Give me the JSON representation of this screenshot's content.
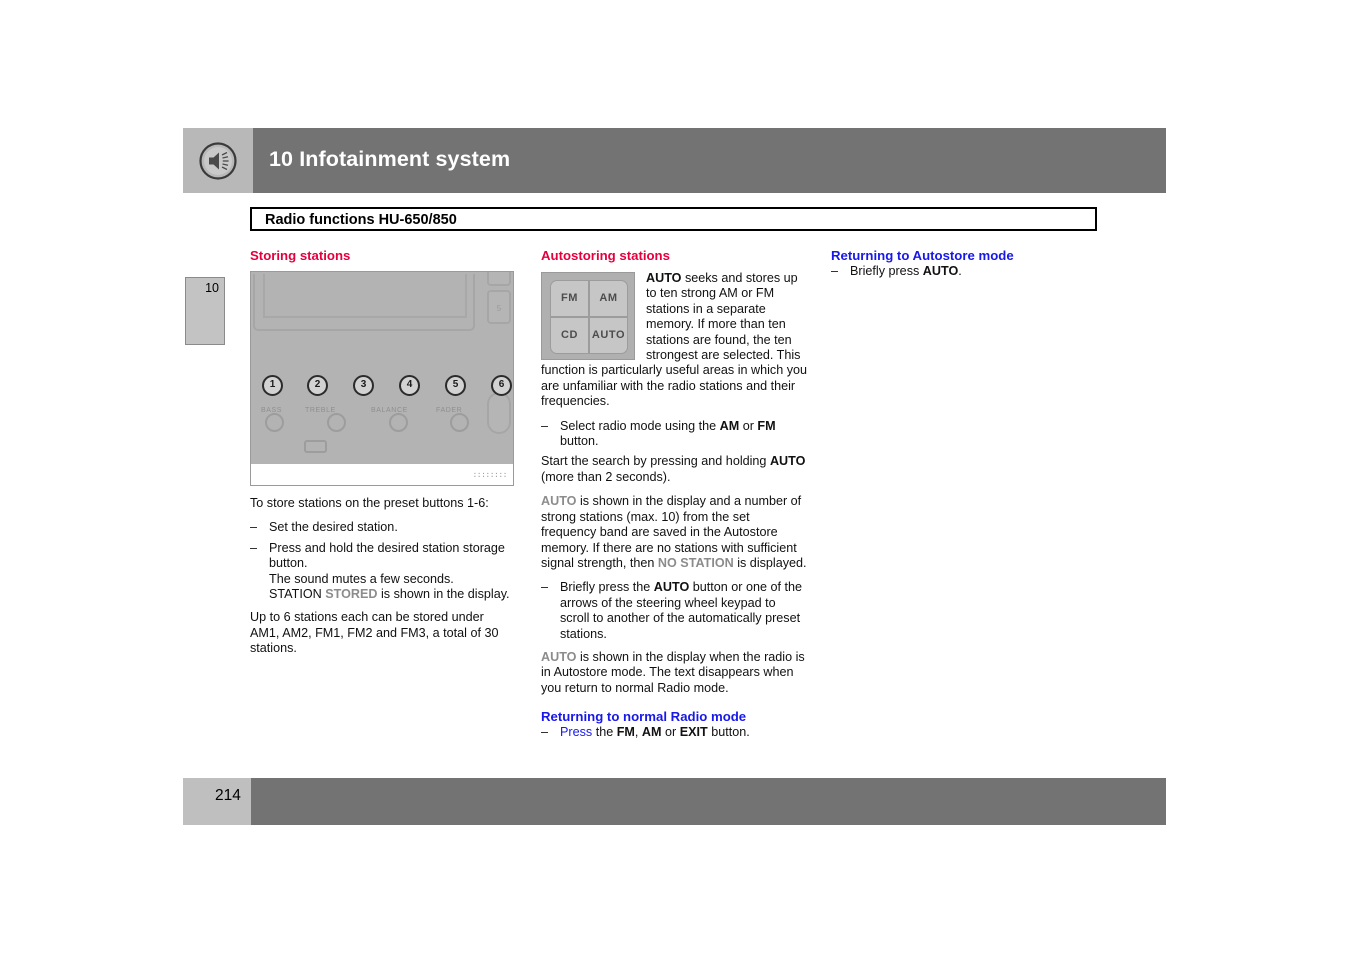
{
  "header": {
    "icon": "speaker-icon",
    "title": "10 Infotainment system",
    "bar_color": "#737373"
  },
  "subtitle": {
    "text": "Radio functions HU-650/850"
  },
  "chapter_tab": {
    "number": "10"
  },
  "footer": {
    "page_number": "214",
    "bar_color": "#737373"
  },
  "colors": {
    "red_heading": "#e4003c",
    "blue_heading": "#1818e8",
    "display_text": "#8c8c8c"
  },
  "columns": {
    "left": {
      "heading": "Storing stations",
      "heading_color": "red",
      "figure": {
        "name": "radio-faceplate-illustration",
        "preset_buttons": [
          "1",
          "2",
          "3",
          "4",
          "5",
          "6"
        ],
        "knob_labels": [
          "BASS",
          "TREBLE",
          "BALANCE",
          "FADER"
        ],
        "side_button_label": "5",
        "watermark": "::::::::"
      },
      "intro": "To store stations on the preset buttons 1-6:",
      "bullets": [
        {
          "dash": "–",
          "segments": [
            {
              "text": "Set the desired station.",
              "style": "normal"
            }
          ]
        },
        {
          "dash": "–",
          "segments": [
            {
              "text": "Press and hold the desired station storage button.",
              "style": "normal"
            },
            {
              "text": "The sound mutes a few seconds.",
              "style": "normal",
              "newline": true
            },
            {
              "text": "STATION ",
              "style": "normal",
              "newline": true
            },
            {
              "text": "STORED",
              "style": "display"
            },
            {
              "text": " is shown in the display.",
              "style": "normal"
            }
          ]
        }
      ],
      "outro": "Up to 6 stations each can be stored under AM1, AM2, FM1, FM2 and FM3, a total of 30 stations."
    },
    "middle": {
      "heading": "Autostoring stations",
      "heading_color": "red",
      "figure": {
        "name": "radio-keypad-illustration",
        "keys": [
          "FM",
          "AM",
          "CD",
          "AUTO"
        ]
      },
      "para1_bold": "AUTO",
      "para1": " seeks and stores up to ten strong AM or FM stations in a separate memory. If more than ten stations are found, the ten strongest are selected. This function is particularly useful areas in which you are unfamiliar with the radio stations and their frequencies.",
      "bullet1_dash": "–",
      "bullet1_a": "Select radio mode using the ",
      "bullet1_b1": "AM",
      "bullet1_c": " or ",
      "bullet1_b2": "FM",
      "bullet1_d": " button.",
      "para2_a": "Start the search by pressing and holding ",
      "para2_bold": "AUTO",
      "para2_b": " (more than 2 seconds).",
      "para3_disp": "AUTO",
      "para3_a": " is shown in the display and a number of strong stations (max. 10) from the set frequency band are saved in the Autostore memory. If there are no stations with sufficient signal strength, then ",
      "para3_disp2": "NO STATION",
      "para3_b": " is displayed.",
      "bullet2_dash": "–",
      "bullet2_a": "Briefly press the ",
      "bullet2_bold": "AUTO",
      "bullet2_b": " button or one of the arrows of the steering wheel keypad to scroll to another of the automatically preset stations.",
      "para4_disp": "AUTO",
      "para4": " is shown in the display when the radio is in Autostore mode. The text disappears when you return to normal Radio mode.",
      "subheading": "Returning to normal Radio mode",
      "subheading_color": "blue",
      "bullet3_dash": "–",
      "bullet3_link": "Press",
      "bullet3_a": " the ",
      "bullet3_b1": "FM",
      "bullet3_c": ", ",
      "bullet3_b2": "AM",
      "bullet3_d": " or ",
      "bullet3_b3": "EXIT",
      "bullet3_e": " button."
    },
    "right": {
      "heading": "Returning to Autostore mode",
      "heading_color": "blue",
      "bullet_dash": "–",
      "bullet_a": "Briefly press ",
      "bullet_bold": "AUTO",
      "bullet_b": "."
    }
  }
}
